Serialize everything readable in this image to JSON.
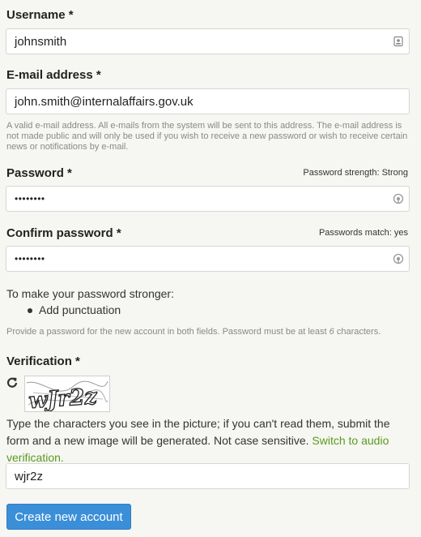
{
  "username": {
    "label": "Username *",
    "value": "johnsmith",
    "icon": "contact-card-icon"
  },
  "email": {
    "label": "E-mail address *",
    "value": "john.smith@internalaffairs.gov.uk",
    "description": "A valid e-mail address. All e-mails from the system will be sent to this address. The e-mail address is not made public and will only be used if you wish to receive a new password or wish to receive certain news or notifications by e-mail."
  },
  "password": {
    "label": "Password *",
    "strength_label": "Password strength:",
    "strength_value": "Strong",
    "value": "••••••••",
    "icon": "password-manager-icon"
  },
  "confirm_password": {
    "label": "Confirm password *",
    "match_label": "Passwords match:",
    "match_value": "yes",
    "value": "••••••••",
    "icon": "password-manager-icon"
  },
  "suggestions": {
    "title": "To make your password stronger:",
    "items": [
      "Add punctuation"
    ]
  },
  "password_help": {
    "before": "Provide a password for the new account in both fields. Password must be at least ",
    "emphasis": "6",
    "after": " characters."
  },
  "verification": {
    "label": "Verification *",
    "captcha_text": "wJr2z",
    "instructions": "Type the characters you see in the picture; if you can't read them, submit the form and a new image will be generated. Not case sensitive.",
    "audio_link": "Switch to audio verification.",
    "value": "wjr2z",
    "refresh_icon": "refresh-icon"
  },
  "submit": {
    "label": "Create new account"
  },
  "colors": {
    "background": "#f6f6f2",
    "button": "#3a8fd8",
    "link": "#5d9a1e"
  }
}
